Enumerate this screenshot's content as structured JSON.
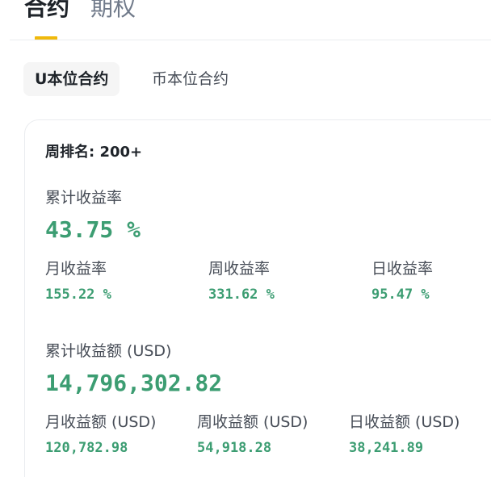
{
  "top_tabs": {
    "active": "合约",
    "inactive": "期权"
  },
  "sub_tabs": {
    "active": "U本位合约",
    "inactive": "币本位合约"
  },
  "card": {
    "rank_label": "周排名: 200+",
    "roi": {
      "total_label": "累计收益率",
      "total_value": "43.75 %",
      "monthly_label": "月收益率",
      "monthly_value": "155.22 %",
      "weekly_label": "周收益率",
      "weekly_value": "331.62 %",
      "daily_label": "日收益率",
      "daily_value": "95.47 %"
    },
    "pnl": {
      "total_label": "累计收益额 (USD)",
      "total_value": "14,796,302.82",
      "monthly_label": "月收益额 (USD)",
      "monthly_value": "120,782.98",
      "weekly_label": "周收益额 (USD)",
      "weekly_value": "54,918.28",
      "daily_label": "日收益额 (USD)",
      "daily_value": "38,241.89"
    }
  },
  "colors": {
    "accent": "#f0b90b",
    "positive": "#3c9d72",
    "text_primary": "#1e2329",
    "text_secondary": "#474d57"
  }
}
